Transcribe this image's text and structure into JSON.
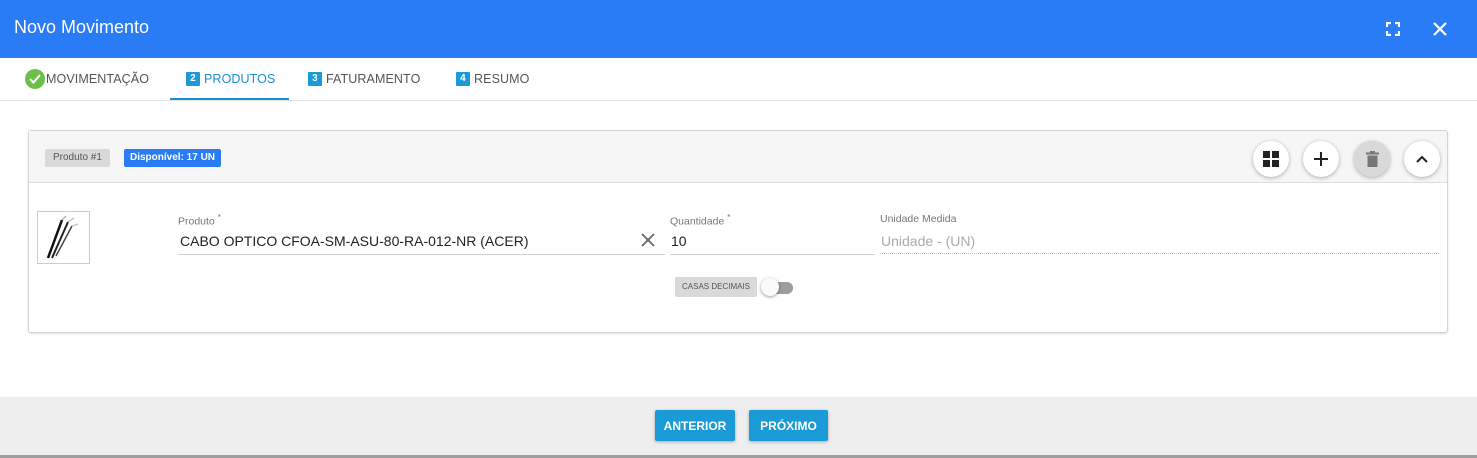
{
  "header": {
    "title": "Novo Movimento"
  },
  "tabs": [
    {
      "label": "MOVIMENTAÇÃO",
      "state": "done"
    },
    {
      "num": "2",
      "label": "PRODUTOS",
      "state": "active"
    },
    {
      "num": "3",
      "label": "FATURAMENTO",
      "state": "pending"
    },
    {
      "num": "4",
      "label": "RESUMO",
      "state": "pending"
    }
  ],
  "product_card": {
    "badge": "Produto #1",
    "available": "Disponível: 17 UN",
    "produto": {
      "label": "Produto",
      "required_mark": "*",
      "value": "CABO OPTICO CFOA-SM-ASU-80-RA-012-NR (ACER)"
    },
    "quantidade": {
      "label": "Quantidade",
      "required_mark": "*",
      "value": "10"
    },
    "unidade": {
      "label": "Unidade Medida",
      "value": "Unidade - (UN)"
    },
    "casas_decimais": {
      "label": "CASAS DECIMAIS",
      "on": false
    }
  },
  "footer": {
    "prev_label": "ANTERIOR",
    "next_label": "PRÓXIMO"
  },
  "colors": {
    "primary": "#2a7cf6",
    "accent": "#1a9bd7",
    "success": "#6cc04a"
  }
}
